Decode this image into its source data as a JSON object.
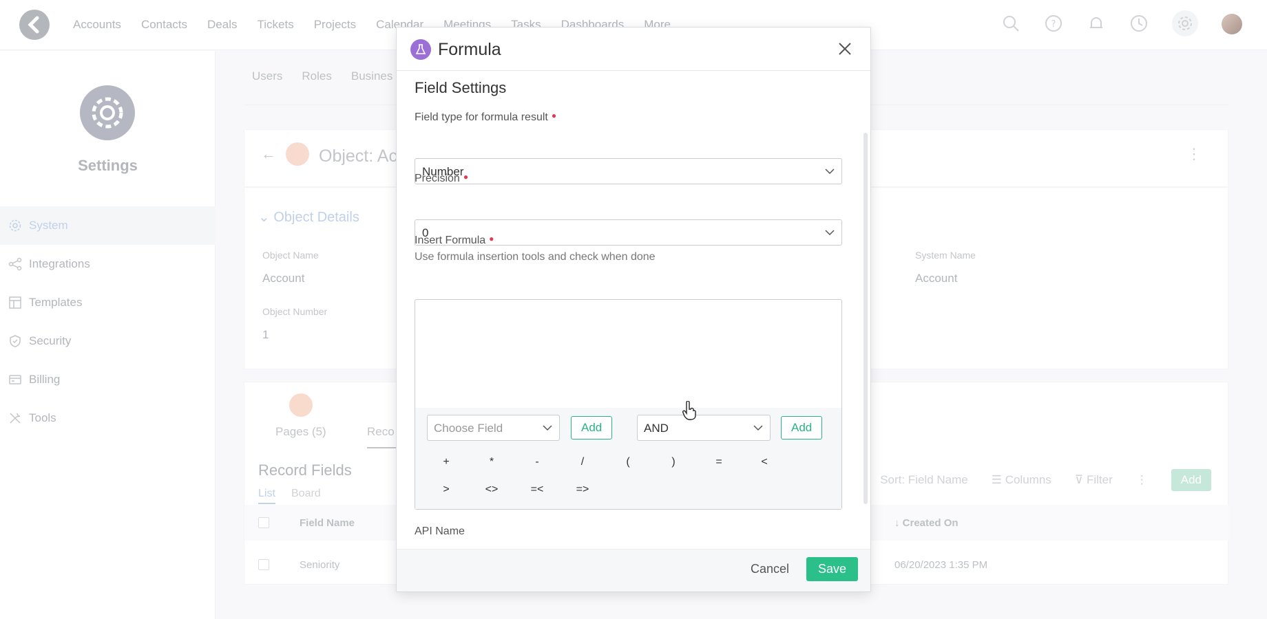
{
  "topnav": [
    "Accounts",
    "Contacts",
    "Deals",
    "Tickets",
    "Projects",
    "Calendar",
    "Meetings",
    "Tasks",
    "Dashboards",
    "More"
  ],
  "sidebar": {
    "title": "Settings",
    "items": [
      {
        "label": "System",
        "icon": "gear-icon"
      },
      {
        "label": "Integrations",
        "icon": "share-icon"
      },
      {
        "label": "Templates",
        "icon": "layout-icon"
      },
      {
        "label": "Security",
        "icon": "shield-icon"
      },
      {
        "label": "Billing",
        "icon": "card-icon"
      },
      {
        "label": "Tools",
        "icon": "tools-icon"
      }
    ]
  },
  "main_tabs": [
    "Users",
    "Roles",
    "Busines"
  ],
  "object": {
    "title": "Object: Ac",
    "details_title": "Object Details",
    "name_label": "Object Name",
    "name_value": "Account",
    "number_label": "Object Number",
    "number_value": "1",
    "system_label": "System Name",
    "system_value": "Account"
  },
  "records": {
    "pages_tab": "Pages (5)",
    "records_tab": "Reco",
    "title": "Record Fields",
    "view_list": "List",
    "view_board": "Board",
    "sort": "Sort: Field Name",
    "columns": "Columns",
    "filter": "Filter",
    "add": "Add",
    "col_field_name": "Field Name",
    "col_created_on": "Created On",
    "row_name": "Seniority",
    "row_created": "06/20/2023 1:35 PM"
  },
  "modal": {
    "title": "Formula",
    "section_title": "Field Settings",
    "field_type_label": "Field type for formula result",
    "field_type_value": "Number",
    "precision_label": "Precision",
    "precision_value": "0",
    "insert_label": "Insert Formula",
    "insert_hint": "Use formula insertion tools and check when done",
    "choose_field_placeholder": "Choose Field",
    "add_label": "Add",
    "logic_value": "AND",
    "operators": [
      "+",
      "*",
      "-",
      "/",
      "(",
      ")",
      "=",
      "<",
      ">",
      "<>",
      "=<",
      "=>"
    ],
    "api_name_label": "API Name",
    "cancel_label": "Cancel",
    "save_label": "Save"
  },
  "colors": {
    "accent": "#2bbf8a",
    "required": "#e63950",
    "formula_icon": "#9b6fd6"
  }
}
